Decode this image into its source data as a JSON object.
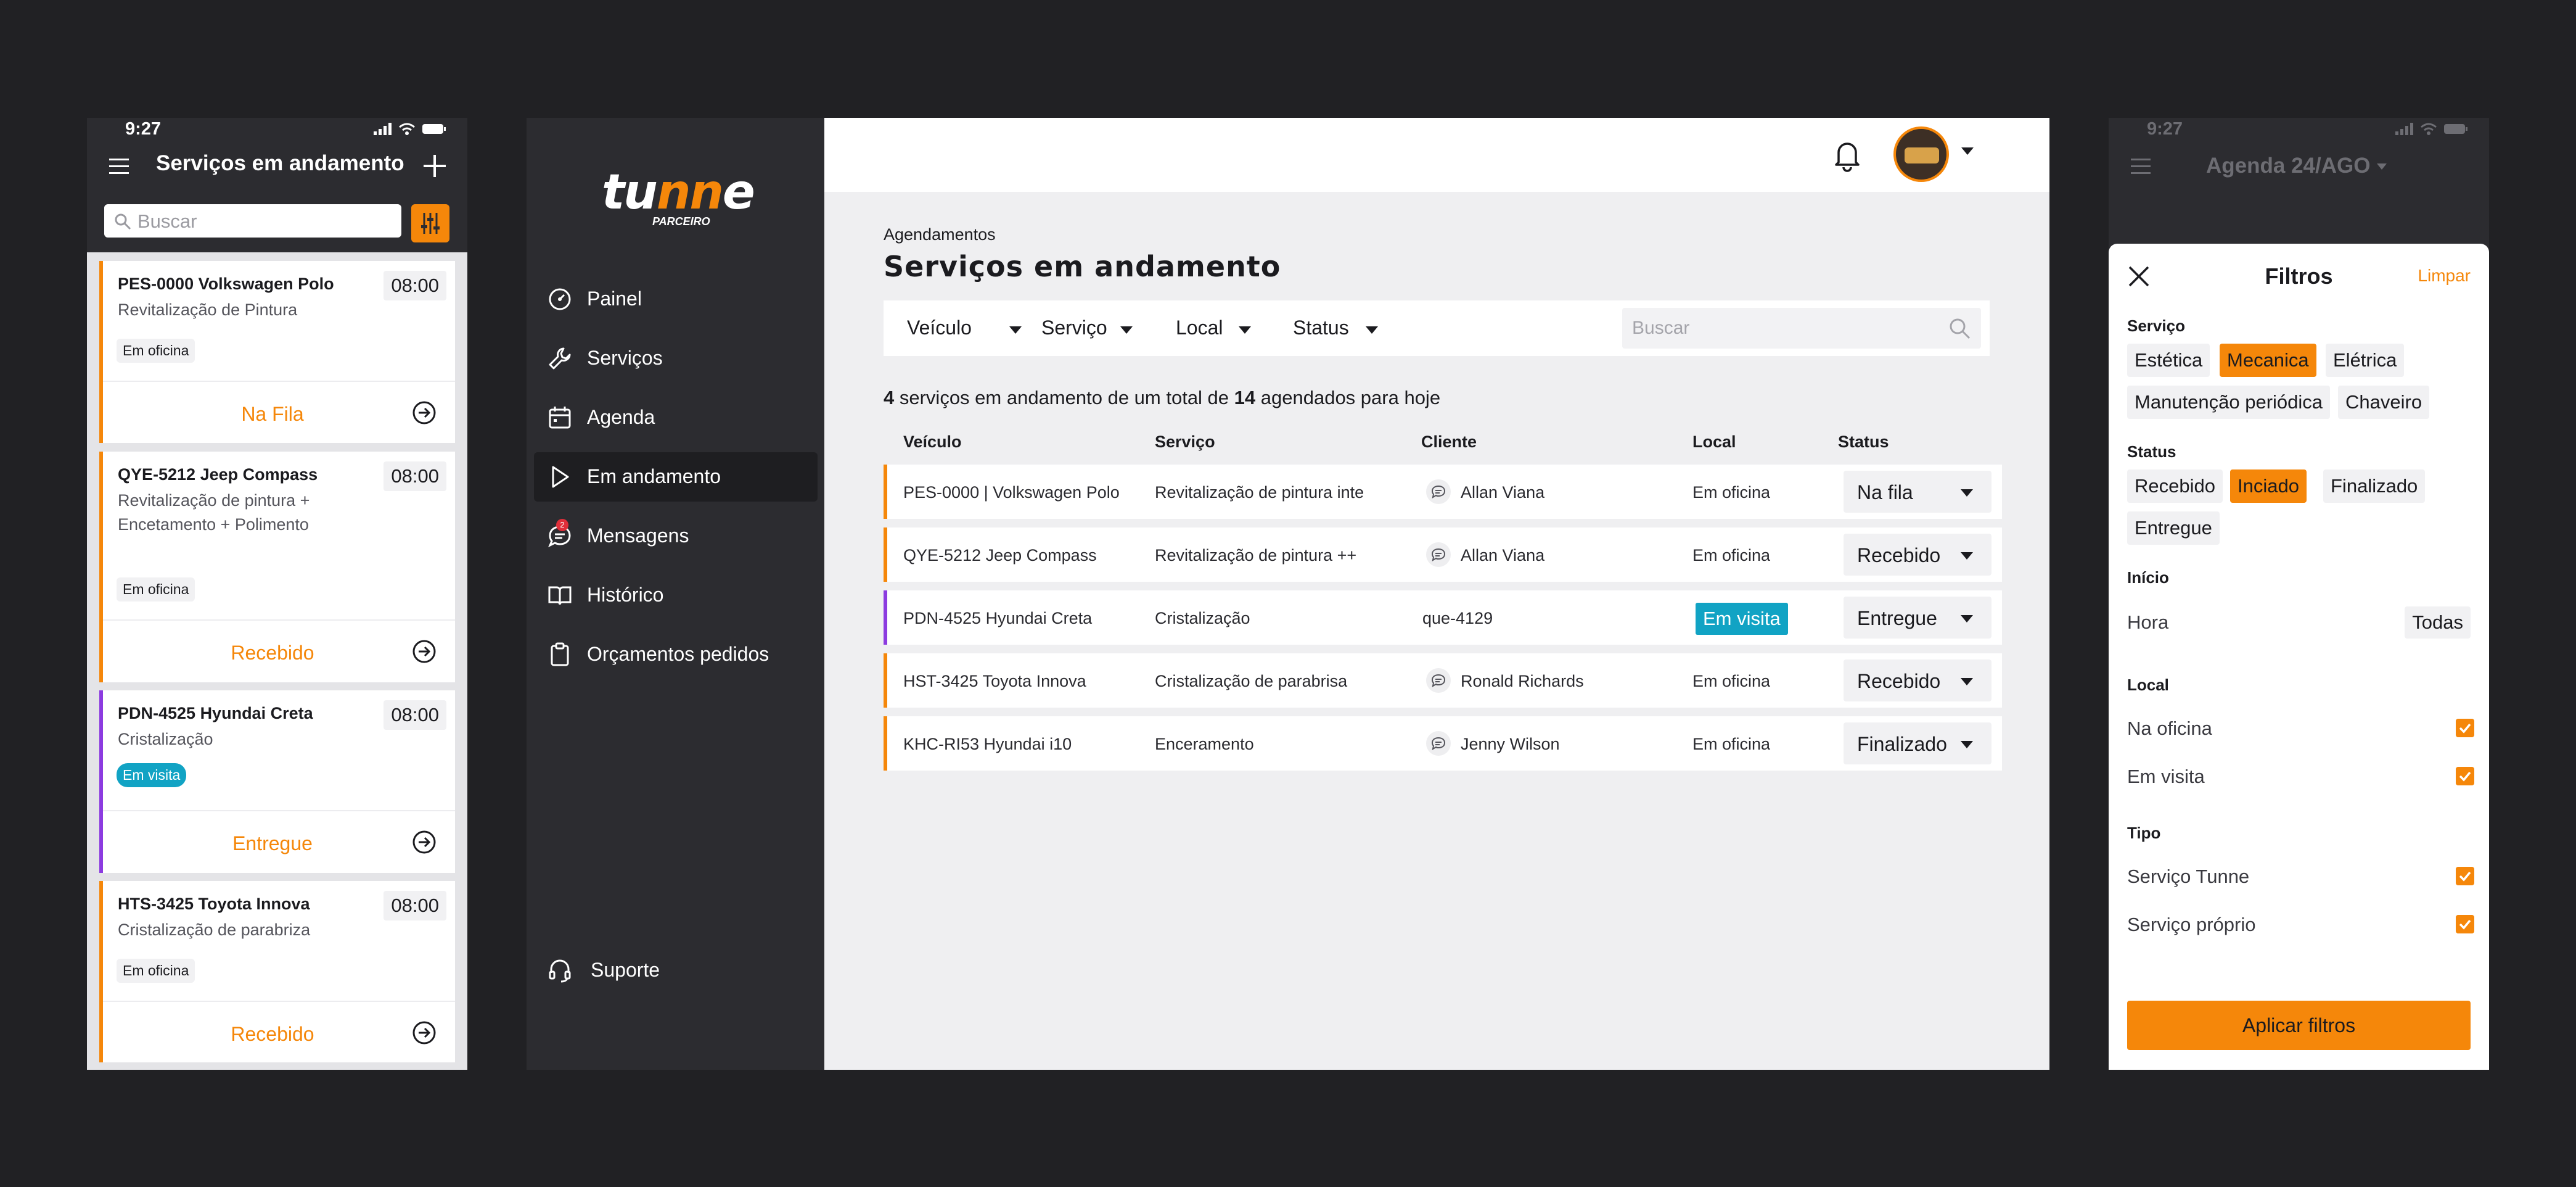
{
  "colors": {
    "accent": "#f5870a",
    "visit": "#11a3c4",
    "purple_bar": "#8c3be0",
    "dark": "#2c2c30"
  },
  "mobile_list": {
    "time": "9:27",
    "title": "Serviços em andamento",
    "search_placeholder": "Buscar",
    "cards": [
      {
        "plate": "PES-0000 Volkswagen Polo",
        "service": "Revitalização de Pintura",
        "time": "08:00",
        "badge": "Em oficina",
        "status": "Na Fila"
      },
      {
        "plate": "QYE-5212 Jeep Compass",
        "service": "Revitalização de pintura + Encetamento + Polimento",
        "time": "08:00",
        "badge": "Em oficina",
        "status": "Recebido"
      },
      {
        "plate": "PDN-4525 Hyundai Creta",
        "service": "Cristalização",
        "time": "08:00",
        "badge": "Em visita",
        "status": "Entregue"
      },
      {
        "plate": "HTS-3425 Toyota Innova",
        "service": "Cristalização de parabriza",
        "time": "08:00",
        "badge": "Em oficina",
        "status": "Recebido"
      }
    ]
  },
  "desktop": {
    "logo": {
      "word_a": "tu",
      "word_b": "nn",
      "word_c": "e",
      "sub": "PARCEIRO"
    },
    "nav": [
      {
        "label": "Painel",
        "icon": "dashboard-icon"
      },
      {
        "label": "Serviços",
        "icon": "wrench-icon"
      },
      {
        "label": "Agenda",
        "icon": "calendar-icon"
      },
      {
        "label": "Em andamento",
        "icon": "play-icon"
      },
      {
        "label": "Mensagens",
        "icon": "chat-icon",
        "badge": "2"
      },
      {
        "label": "Histórico",
        "icon": "book-icon"
      },
      {
        "label": "Orçamentos pedidos",
        "icon": "clipboard-icon"
      }
    ],
    "support": "Suporte",
    "breadcrumb": "Agendamentos",
    "page_title": "Serviços em andamento",
    "filters": {
      "vehicle": "Veículo",
      "service": "Serviço",
      "local": "Local",
      "status": "Status"
    },
    "search_placeholder": "Buscar",
    "summary": {
      "count": "4",
      "text1": " serviços em andamento de um total de ",
      "total": "14",
      "text2": " agendados para hoje"
    },
    "columns": {
      "vehicle": "Veículo",
      "service": "Serviço",
      "client": "Cliente",
      "local": "Local",
      "status": "Status"
    },
    "rows": [
      {
        "vehicle": "PES-0000 |  Volkswagen Polo",
        "service": "Revitalização de pintura inte",
        "client": "Allan Viana",
        "local": "Em oficina",
        "status": "Na fila"
      },
      {
        "vehicle": "QYE-5212  Jeep Compass",
        "service": "Revitalização de pintura ++",
        "client": "Allan Viana",
        "local": "Em oficina",
        "status": "Recebido"
      },
      {
        "vehicle": "PDN-4525  Hyundai Creta",
        "service": "Cristalização",
        "client": "que-4129",
        "local": "Em visita",
        "status": "Entregue"
      },
      {
        "vehicle": "HST-3425  Toyota Innova",
        "service": "Cristalização de parabrisa",
        "client": "Ronald Richards",
        "local": "Em oficina",
        "status": "Recebido"
      },
      {
        "vehicle": "KHC-RI53  Hyundai i10",
        "service": "Enceramento",
        "client": "Jenny Wilson",
        "local": "Em oficina",
        "status": "Finalizado"
      }
    ]
  },
  "mobile_filters": {
    "time": "9:27",
    "title": "Agenda 24/AGO",
    "sheet_title": "Filtros",
    "clear": "Limpar",
    "service_label": "Serviço",
    "service_chips": [
      "Estética",
      "Mecanica",
      "Elétrica",
      "Manutenção periódica",
      "Chaveiro"
    ],
    "status_label": "Status",
    "status_chips": [
      "Recebido",
      "Inciado",
      "Finalizado",
      "Entregue"
    ],
    "start_label": "Início",
    "hour_label": "Hora",
    "hour_value": "Todas",
    "local_label": "Local",
    "local_options": [
      "Na oficina",
      "Em visita"
    ],
    "type_label": "Tipo",
    "type_options": [
      "Serviço Tunne",
      "Serviço próprio"
    ],
    "apply": "Aplicar filtros"
  }
}
